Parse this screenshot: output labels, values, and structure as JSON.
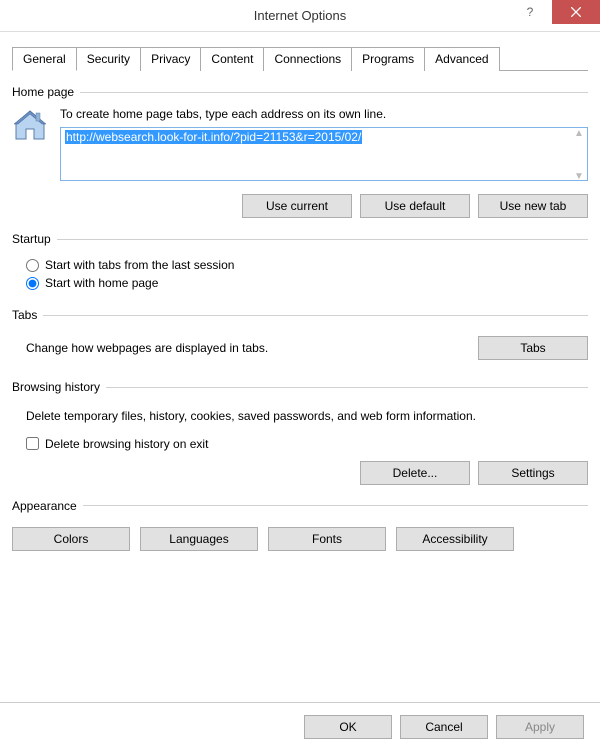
{
  "title": "Internet Options",
  "tabs": [
    "General",
    "Security",
    "Privacy",
    "Content",
    "Connections",
    "Programs",
    "Advanced"
  ],
  "home": {
    "legend": "Home page",
    "help": "To create home page tabs, type each address on its own line.",
    "url": "http://websearch.look-for-it.info/?pid=21153&r=2015/02/",
    "use_current": "Use current",
    "use_default": "Use default",
    "use_new_tab": "Use new tab"
  },
  "startup": {
    "legend": "Startup",
    "opt_last": "Start with tabs from the last session",
    "opt_home": "Start with home page"
  },
  "tabs_section": {
    "legend": "Tabs",
    "help": "Change how webpages are displayed in tabs.",
    "btn": "Tabs"
  },
  "history": {
    "legend": "Browsing history",
    "help": "Delete temporary files, history, cookies, saved passwords, and web form information.",
    "check": "Delete browsing history on exit",
    "delete": "Delete...",
    "settings": "Settings"
  },
  "appearance": {
    "legend": "Appearance",
    "colors": "Colors",
    "languages": "Languages",
    "fonts": "Fonts",
    "accessibility": "Accessibility"
  },
  "footer": {
    "ok": "OK",
    "cancel": "Cancel",
    "apply": "Apply"
  }
}
